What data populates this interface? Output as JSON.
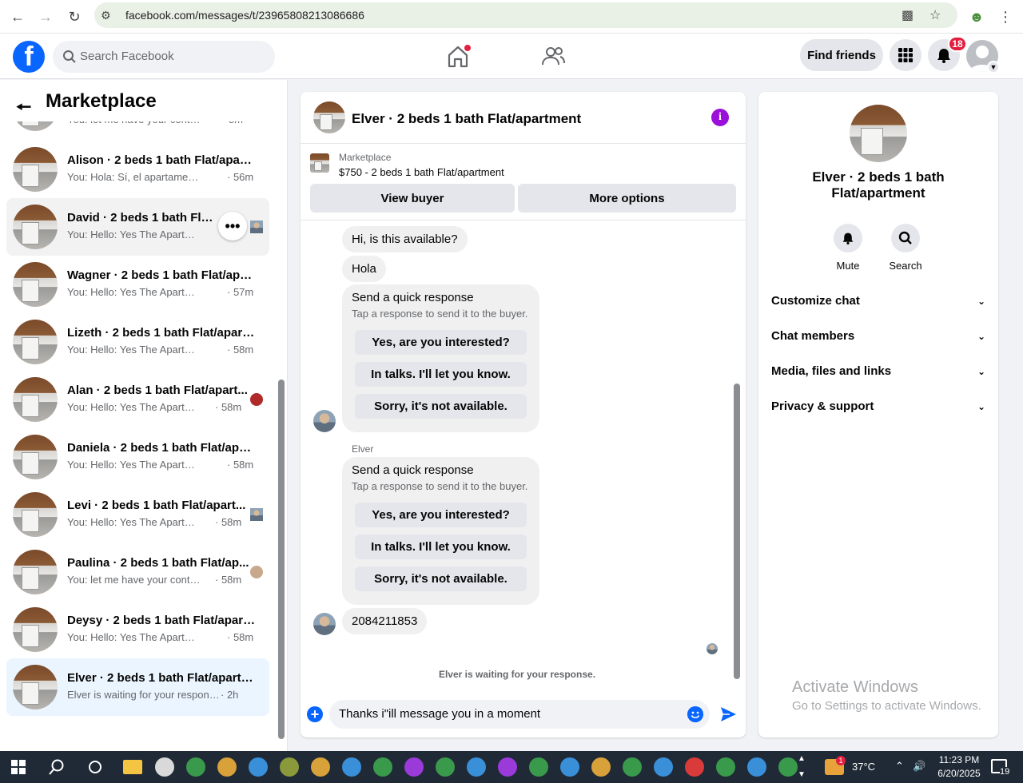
{
  "browser": {
    "url": "facebook.com/messages/t/23965808213086686"
  },
  "header": {
    "search_placeholder": "Search Facebook",
    "find_friends": "Find friends",
    "notification_count": "18"
  },
  "sidebar": {
    "title": "Marketplace",
    "partial_item": {
      "snippet": "You: let me have your contact n...",
      "time": "· 8m"
    },
    "items": [
      {
        "name": "Alison · 2 beds 1 bath Flat/apart...",
        "snippet": "You: Hola: Sí, el apartamento tod...",
        "time": "· 56m"
      },
      {
        "name": "David · 2 beds 1 bath Flat/ap",
        "snippet": "You: Hello: Yes The Apartment",
        "time": ""
      },
      {
        "name": "Wagner · 2 beds 1 bath Flat/apar...",
        "snippet": "You: Hello: Yes The Apartment Is ...",
        "time": "· 57m"
      },
      {
        "name": "Lizeth · 2 beds 1 bath Flat/apart...",
        "snippet": "You: Hello: Yes The Apartment Is ...",
        "time": "· 58m"
      },
      {
        "name": "Alan · 2 beds 1 bath Flat/apart...",
        "snippet": "You: Hello: Yes The Apartment ...",
        "time": "· 58m"
      },
      {
        "name": "Daniela · 2 beds 1 bath Flat/apar...",
        "snippet": "You: Hello: Yes The Apartment Is ...",
        "time": "· 58m"
      },
      {
        "name": "Levi · 2 beds 1 bath Flat/apart...",
        "snippet": "You: Hello: Yes The Apartment ...",
        "time": "· 58m"
      },
      {
        "name": "Paulina · 2 beds 1 bath Flat/ap...",
        "snippet": "You: let me have your contact ...",
        "time": "· 58m"
      },
      {
        "name": "Deysy · 2 beds 1 bath Flat/apart...",
        "snippet": "You: Hello: Yes The Apartment Is ...",
        "time": "· 58m"
      },
      {
        "name": "Elver · 2 beds 1 bath Flat/apartm...",
        "snippet": "Elver is waiting for your response.",
        "time": "· 2h"
      }
    ]
  },
  "chat": {
    "title": "Elver · 2 beds 1 bath Flat/apartment",
    "listing_label": "Marketplace",
    "listing_price": "$750 - 2 beds 1 bath Flat/apartment",
    "view_buyer": "View buyer",
    "more_options": "More options",
    "messages": {
      "m1": "Hi, is this available?",
      "m2": "Hola",
      "qr_title": "Send a quick response",
      "qr_sub": "Tap a response to send it to the buyer.",
      "qr_options": [
        "Yes, are you interested?",
        "In talks. I'll let you know.",
        "Sorry, it's not available."
      ],
      "sender": "Elver",
      "phone": "2084211853"
    },
    "waiting": "Elver is waiting for your response.",
    "composer_text": "Thanks i\"ill message you in a moment"
  },
  "right_panel": {
    "title": "Elver · 2 beds 1 bath Flat/apartment",
    "mute": "Mute",
    "search": "Search",
    "sections": [
      "Customize chat",
      "Chat members",
      "Media, files and links",
      "Privacy & support"
    ],
    "activate_title": "Activate Windows",
    "activate_sub": "Go to Settings to activate Windows."
  },
  "taskbar": {
    "temperature": "37°C",
    "weather_badge": "1",
    "time": "11:23 PM",
    "date": "6/20/2025",
    "notif_count": "19"
  },
  "colors": {
    "fb_blue": "#0866ff",
    "info_purple": "#9b10d9",
    "badge_red": "#e41e3f"
  }
}
